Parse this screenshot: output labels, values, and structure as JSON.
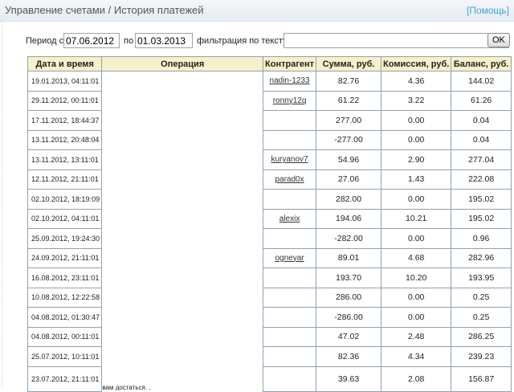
{
  "header": {
    "title": "Управление счетами / История платежей",
    "help": "[Помощь]"
  },
  "filter": {
    "period_from_label": "Период с",
    "from": "07.06.2012",
    "to_label": "по",
    "to": "01.03.2013",
    "text_label": "фильтрация по тексту",
    "text": "",
    "ok": "OK"
  },
  "table": {
    "columns": [
      "Дата и время",
      "Операция",
      "Контрагент",
      "Сумма, руб.",
      "Комиссия, руб.",
      "Баланс, руб."
    ],
    "rows": [
      {
        "date": "19.01.2013, 04:11:01",
        "op": "",
        "partner": "nadin-1233",
        "sum": "82.76",
        "fee": "4.36",
        "balance": "144.02"
      },
      {
        "date": "29.11.2012, 00:11:01",
        "op": "",
        "partner": "ronny12q",
        "sum": "61.22",
        "fee": "3.22",
        "balance": "61.26"
      },
      {
        "date": "17.11.2012, 18:44:37",
        "op": "",
        "partner": "",
        "sum": "277.00",
        "fee": "0.00",
        "balance": "0.04"
      },
      {
        "date": "13.11.2012, 20:48:04",
        "op": "",
        "partner": "",
        "sum": "-277.00",
        "fee": "0.00",
        "balance": "0.04"
      },
      {
        "date": "13.11.2012, 13:11:01",
        "op": "",
        "partner": "kuryanov7",
        "sum": "54.96",
        "fee": "2.90",
        "balance": "277.04"
      },
      {
        "date": "12.11.2012, 21:11:01",
        "op": "",
        "partner": "parad0x",
        "sum": "27.06",
        "fee": "1.43",
        "balance": "222.08"
      },
      {
        "date": "02.10.2012, 18:19:09",
        "op": "",
        "partner": "",
        "sum": "282.00",
        "fee": "0.00",
        "balance": "195.02"
      },
      {
        "date": "02.10.2012, 04:11:01",
        "op": "",
        "partner": "alexix",
        "sum": "194.06",
        "fee": "10.21",
        "balance": "195.02"
      },
      {
        "date": "25.09.2012, 19:24:30",
        "op": "",
        "partner": "",
        "sum": "-282.00",
        "fee": "0.00",
        "balance": "0.96"
      },
      {
        "date": "24.09.2012, 21:11:01",
        "op": "",
        "partner": "ogneyar",
        "sum": "89.01",
        "fee": "4.68",
        "balance": "282.96"
      },
      {
        "date": "16.08.2012, 23:11:01",
        "op": "",
        "partner": "",
        "sum": "193.70",
        "fee": "10.20",
        "balance": "193.95"
      },
      {
        "date": "10.08.2012, 12:22:58",
        "op": "",
        "partner": "",
        "sum": "286.00",
        "fee": "0.00",
        "balance": "0.25"
      },
      {
        "date": "04.08.2012, 01:30:47",
        "op": "",
        "partner": "",
        "sum": "-286.00",
        "fee": "0.00",
        "balance": "0.25"
      },
      {
        "date": "04.08.2012, 00:11:01",
        "op": "",
        "partner": "",
        "sum": "47.02",
        "fee": "2.48",
        "balance": "286.25"
      },
      {
        "date": "25.07.2012, 10:11:01",
        "op": "",
        "partner": "",
        "sum": "82.36",
        "fee": "4.34",
        "balance": "239.23"
      },
      {
        "date": "23.07.2012, 21:11:01",
        "op": "вам достаться. ,",
        "partner": "",
        "sum": "39.63",
        "fee": "2.08",
        "balance": "156.87"
      }
    ]
  }
}
